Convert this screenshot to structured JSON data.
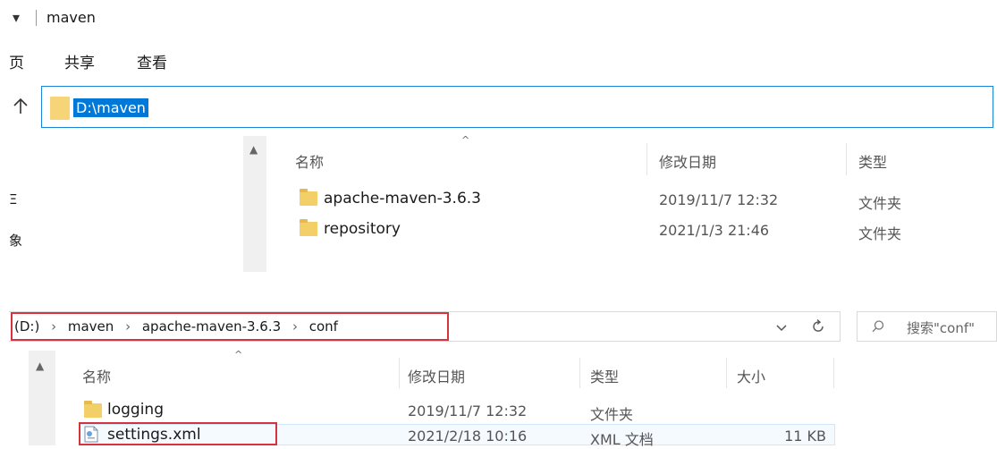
{
  "window": {
    "title": "maven",
    "quick_access_glyph": "▾",
    "ribbon_tabs": [
      {
        "label": "页"
      },
      {
        "label": "共享"
      },
      {
        "label": "查看"
      }
    ]
  },
  "top_pane": {
    "address_value": "D:\\maven",
    "columns": {
      "name": "名称",
      "modified": "修改日期",
      "type": "类型"
    },
    "left_labels": [
      "Ξ",
      "象"
    ],
    "rows": [
      {
        "name": "apache-maven-3.6.3",
        "modified": "2019/11/7 12:32",
        "type": "文件夹"
      },
      {
        "name": "repository",
        "modified": "2021/1/3 21:46",
        "type": "文件夹"
      }
    ]
  },
  "bottom_pane": {
    "breadcrumb": [
      "(D:)",
      "maven",
      "apache-maven-3.6.3",
      "conf"
    ],
    "search_placeholder": "搜索\"conf\"",
    "columns": {
      "name": "名称",
      "modified": "修改日期",
      "type": "类型",
      "size": "大小"
    },
    "rows": [
      {
        "name": "logging",
        "modified": "2019/11/7 12:32",
        "type": "文件夹",
        "size": ""
      },
      {
        "name": "settings.xml",
        "modified": "2021/2/18 10:16",
        "type": "XML 文档",
        "size": "11 KB"
      }
    ]
  },
  "colors": {
    "highlight_box": "#d5343f",
    "selection": "#0078d7",
    "address_border": "#1a85d6"
  }
}
